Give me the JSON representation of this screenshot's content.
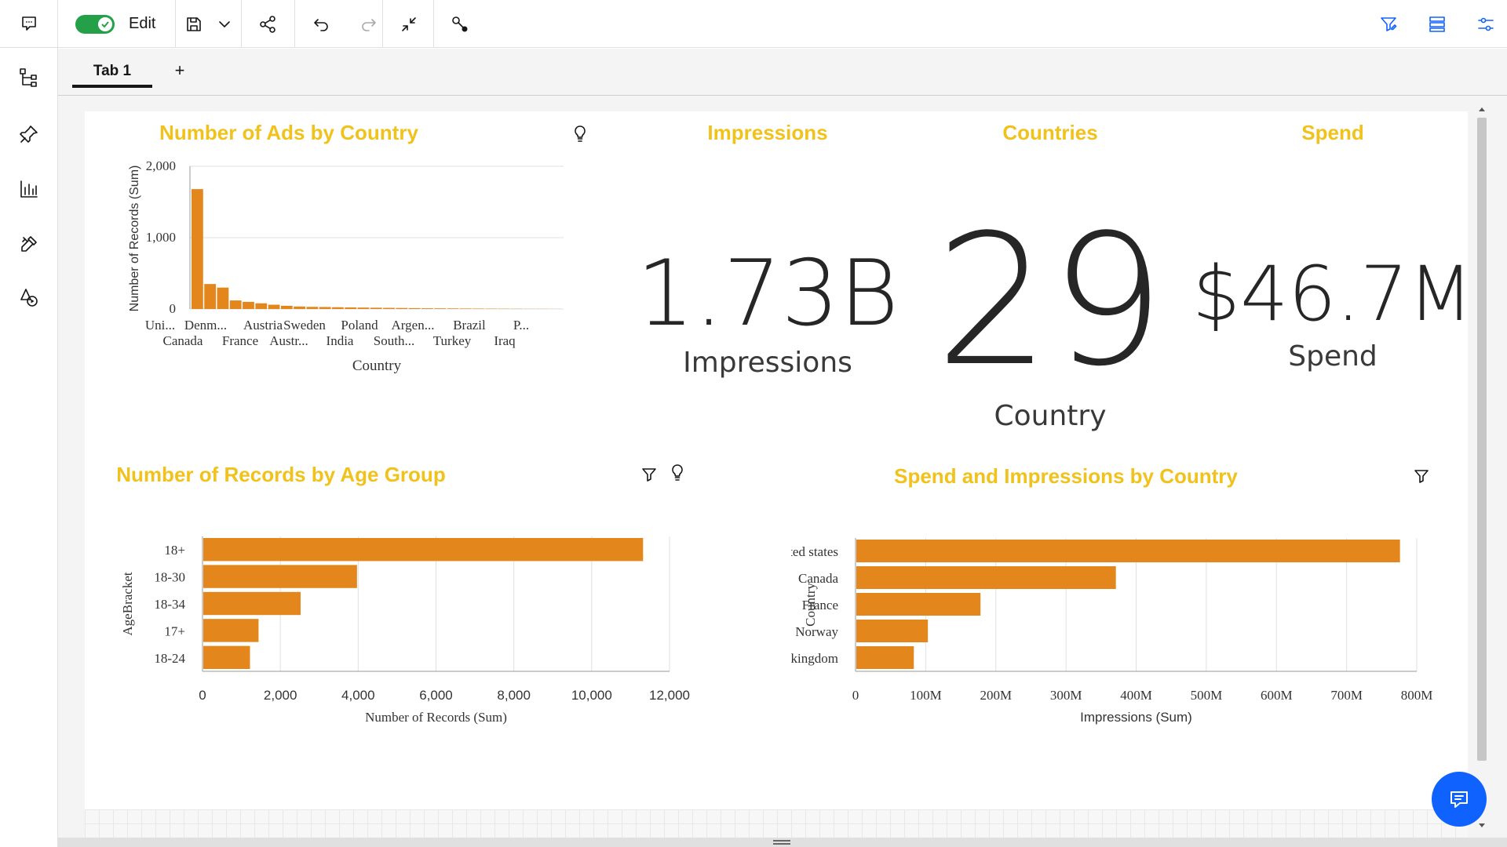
{
  "toolbar": {
    "edit_label": "Edit",
    "edit_on": true
  },
  "tabs": [
    {
      "label": "Tab 1"
    }
  ],
  "tab_add_label": "+",
  "widgets": {
    "ads_by_country": {
      "title": "Number of Ads by Country"
    },
    "impressions": {
      "title": "Impressions",
      "value": "1.73B",
      "label": "Impressions"
    },
    "countries": {
      "title": "Countries",
      "value": "29",
      "label": "Country"
    },
    "spend": {
      "title": "Spend",
      "value": "$46.7M",
      "label": "Spend"
    },
    "age_group": {
      "title": "Number of Records by Age Group"
    },
    "spend_impressions": {
      "title": "Spend and Impressions by Country"
    }
  },
  "chart_data": [
    {
      "type": "bar",
      "title": "Number of Ads by Country",
      "xlabel": "Country",
      "ylabel": "Number of Records (Sum)",
      "ylim": [
        0,
        2000
      ],
      "yticks": [
        "0",
        "1,000",
        "2,000"
      ],
      "xtick_labels_row1": [
        "Uni...",
        "Denm...",
        "Austria",
        "Sweden",
        "Poland",
        "Argen...",
        "Brazil",
        "P..."
      ],
      "xtick_labels_row2": [
        "Canada",
        "France",
        "Austr...",
        "India",
        "South...",
        "Turkey",
        "Iraq"
      ],
      "values": [
        1680,
        350,
        300,
        120,
        100,
        80,
        60,
        45,
        35,
        30,
        28,
        25,
        22,
        20,
        18,
        16,
        14,
        12,
        10,
        9,
        8,
        7,
        6,
        5,
        4,
        3,
        2,
        2,
        1
      ],
      "color": "#e3861c"
    },
    {
      "type": "bar",
      "orientation": "horizontal",
      "title": "Number of Records by Age Group",
      "categories": [
        "18+",
        "18-30",
        "18-34",
        "17+",
        "18-24"
      ],
      "values": [
        11300,
        3950,
        2500,
        1420,
        1200
      ],
      "xlabel": "Number of Records (Sum)",
      "ylabel": "AgeBracket",
      "xlim": [
        0,
        12000
      ],
      "xticks": [
        "0",
        "2,000",
        "4,000",
        "6,000",
        "8,000",
        "10,000",
        "12,000"
      ],
      "color": "#e3861c"
    },
    {
      "type": "bar",
      "orientation": "horizontal",
      "title": "Spend and Impressions by Country",
      "categories": [
        "United states",
        "Canada",
        "France",
        "Norway",
        "United kingdom"
      ],
      "values": [
        775,
        370,
        177,
        102,
        82
      ],
      "value_unit": "M",
      "xlabel": "Impressions (Sum)",
      "ylabel": "Country",
      "xlim": [
        0,
        800
      ],
      "xticks": [
        "0",
        "100M",
        "200M",
        "300M",
        "400M",
        "500M",
        "600M",
        "700M",
        "800M"
      ],
      "color": "#e3861c"
    }
  ]
}
